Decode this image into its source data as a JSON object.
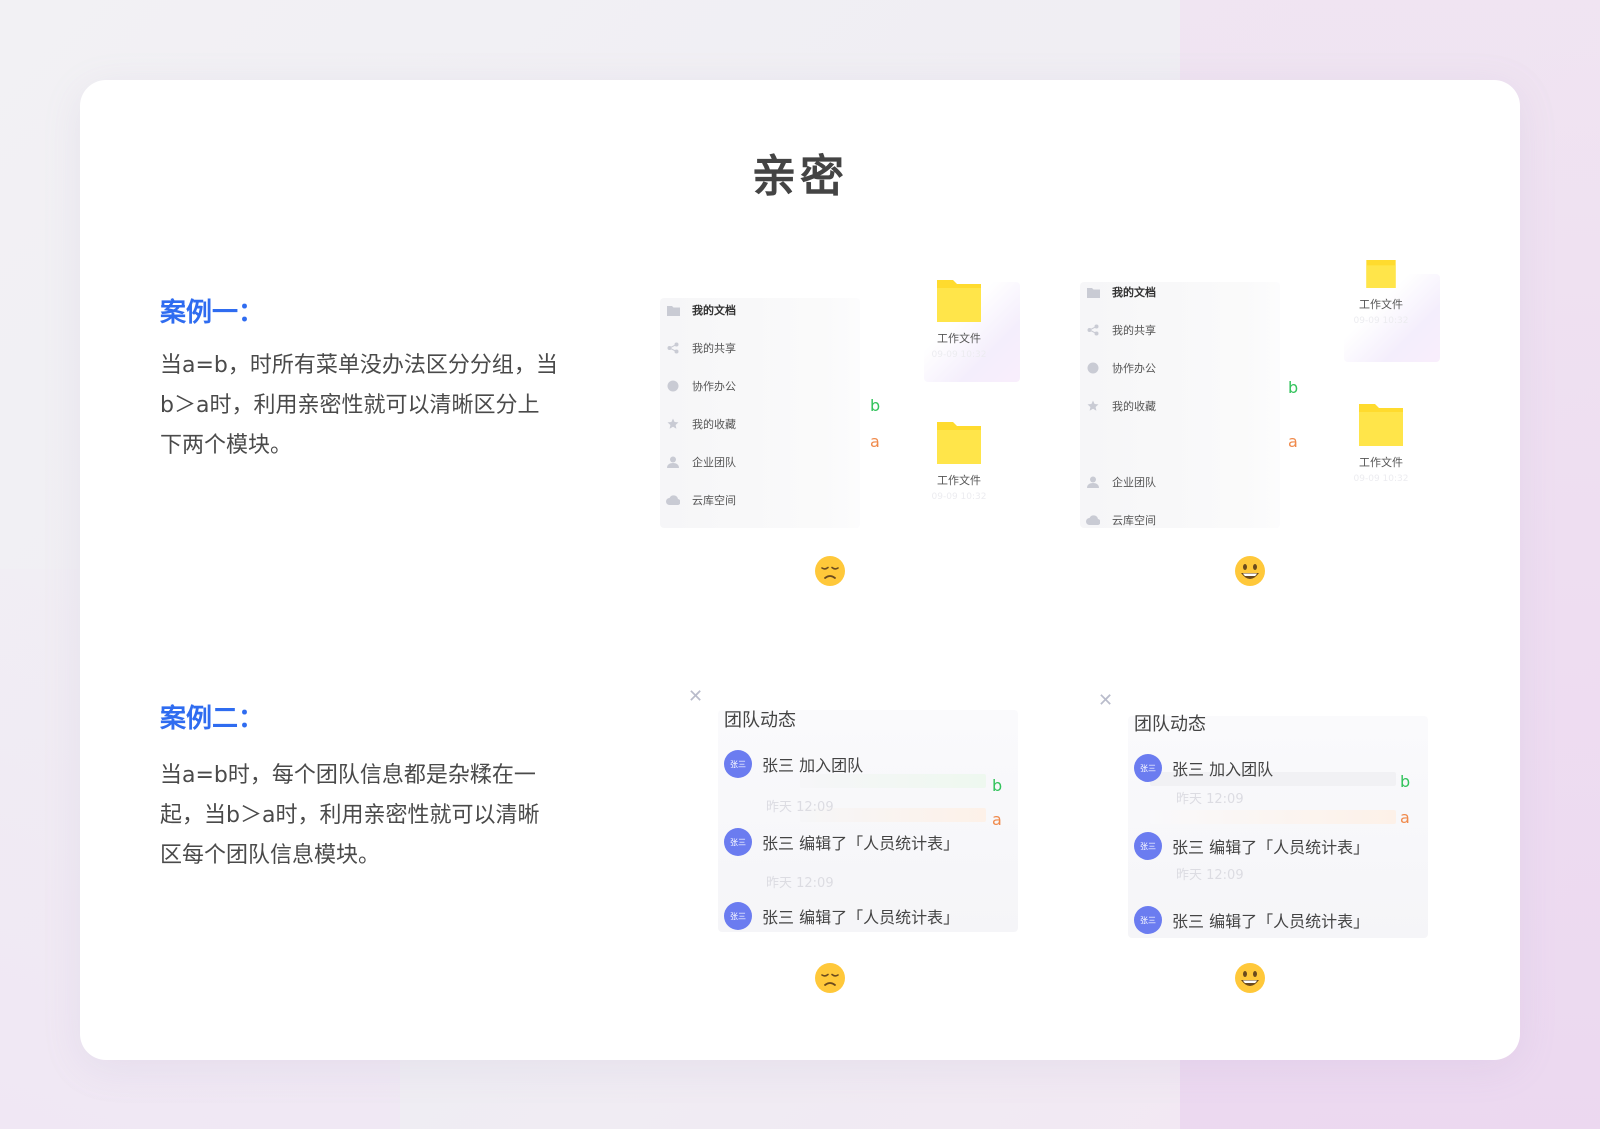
{
  "page": {
    "title": "亲密"
  },
  "case1": {
    "heading": "案例一：",
    "desc": "当a=b，时所有菜单没办法区分分组，当b＞a时，利用亲密性就可以清晰区分上下两个模块。",
    "bad_example": {
      "menu": [
        {
          "label": "我的文档",
          "icon": "folder-icon"
        },
        {
          "label": "我的共享",
          "icon": "share-icon"
        },
        {
          "label": "协作办公",
          "icon": "globe-icon"
        },
        {
          "label": "我的收藏",
          "icon": "star-icon"
        },
        {
          "label": "企业团队",
          "icon": "team-icon"
        },
        {
          "label": "云库空间",
          "icon": "cloud-icon"
        }
      ],
      "files": [
        {
          "name": "工作文件",
          "date": "09-09 10:32"
        },
        {
          "name": "工作文件",
          "date": "09-09 10:32"
        }
      ],
      "label_b": "b",
      "label_a": "a",
      "mood": "sad-face-icon"
    },
    "good_example": {
      "menu": [
        {
          "label": "我的文档",
          "icon": "folder-icon"
        },
        {
          "label": "我的共享",
          "icon": "share-icon"
        },
        {
          "label": "协作办公",
          "icon": "globe-icon"
        },
        {
          "label": "我的收藏",
          "icon": "star-icon"
        },
        {
          "label": "企业团队",
          "icon": "team-icon"
        },
        {
          "label": "云库空间",
          "icon": "cloud-icon"
        }
      ],
      "files": [
        {
          "name": "工作文件",
          "date": "09-09 10:32"
        },
        {
          "name": "工作文件",
          "date": "09-09 10:32"
        }
      ],
      "label_b": "b",
      "label_a": "a",
      "mood": "smile-face-icon"
    }
  },
  "case2": {
    "heading": "案例二：",
    "desc": "当a=b时，每个团队信息都是杂糅在一起，当b＞a时，利用亲密性就可以清晰区每个团队信息模块。",
    "bad_example": {
      "title": "团队动态",
      "avatar_text": "张三",
      "rows": [
        {
          "text": "张三 加入团队",
          "time": "昨天 12:09"
        },
        {
          "text": "张三 编辑了「人员统计表」",
          "time": "昨天 12:09"
        },
        {
          "text": "张三 编辑了「人员统计表」",
          "time": ""
        }
      ],
      "label_b": "b",
      "label_a": "a",
      "mood": "sad-face-icon"
    },
    "good_example": {
      "title": "团队动态",
      "avatar_text": "张三",
      "rows": [
        {
          "text": "张三 加入团队",
          "time": "昨天 12:09"
        },
        {
          "text": "张三 编辑了「人员统计表」",
          "time": "昨天 12:09"
        },
        {
          "text": "张三 编辑了「人员统计表」",
          "time": ""
        }
      ],
      "label_b": "b",
      "label_a": "a",
      "mood": "smile-face-icon"
    }
  },
  "colors": {
    "accent_blue": "#2f6cf0",
    "label_b_green": "#33c35c",
    "label_a_orange": "#f08a4b",
    "avatar": "#6b7cf0",
    "folder_yellow": "#ffdb2e"
  }
}
